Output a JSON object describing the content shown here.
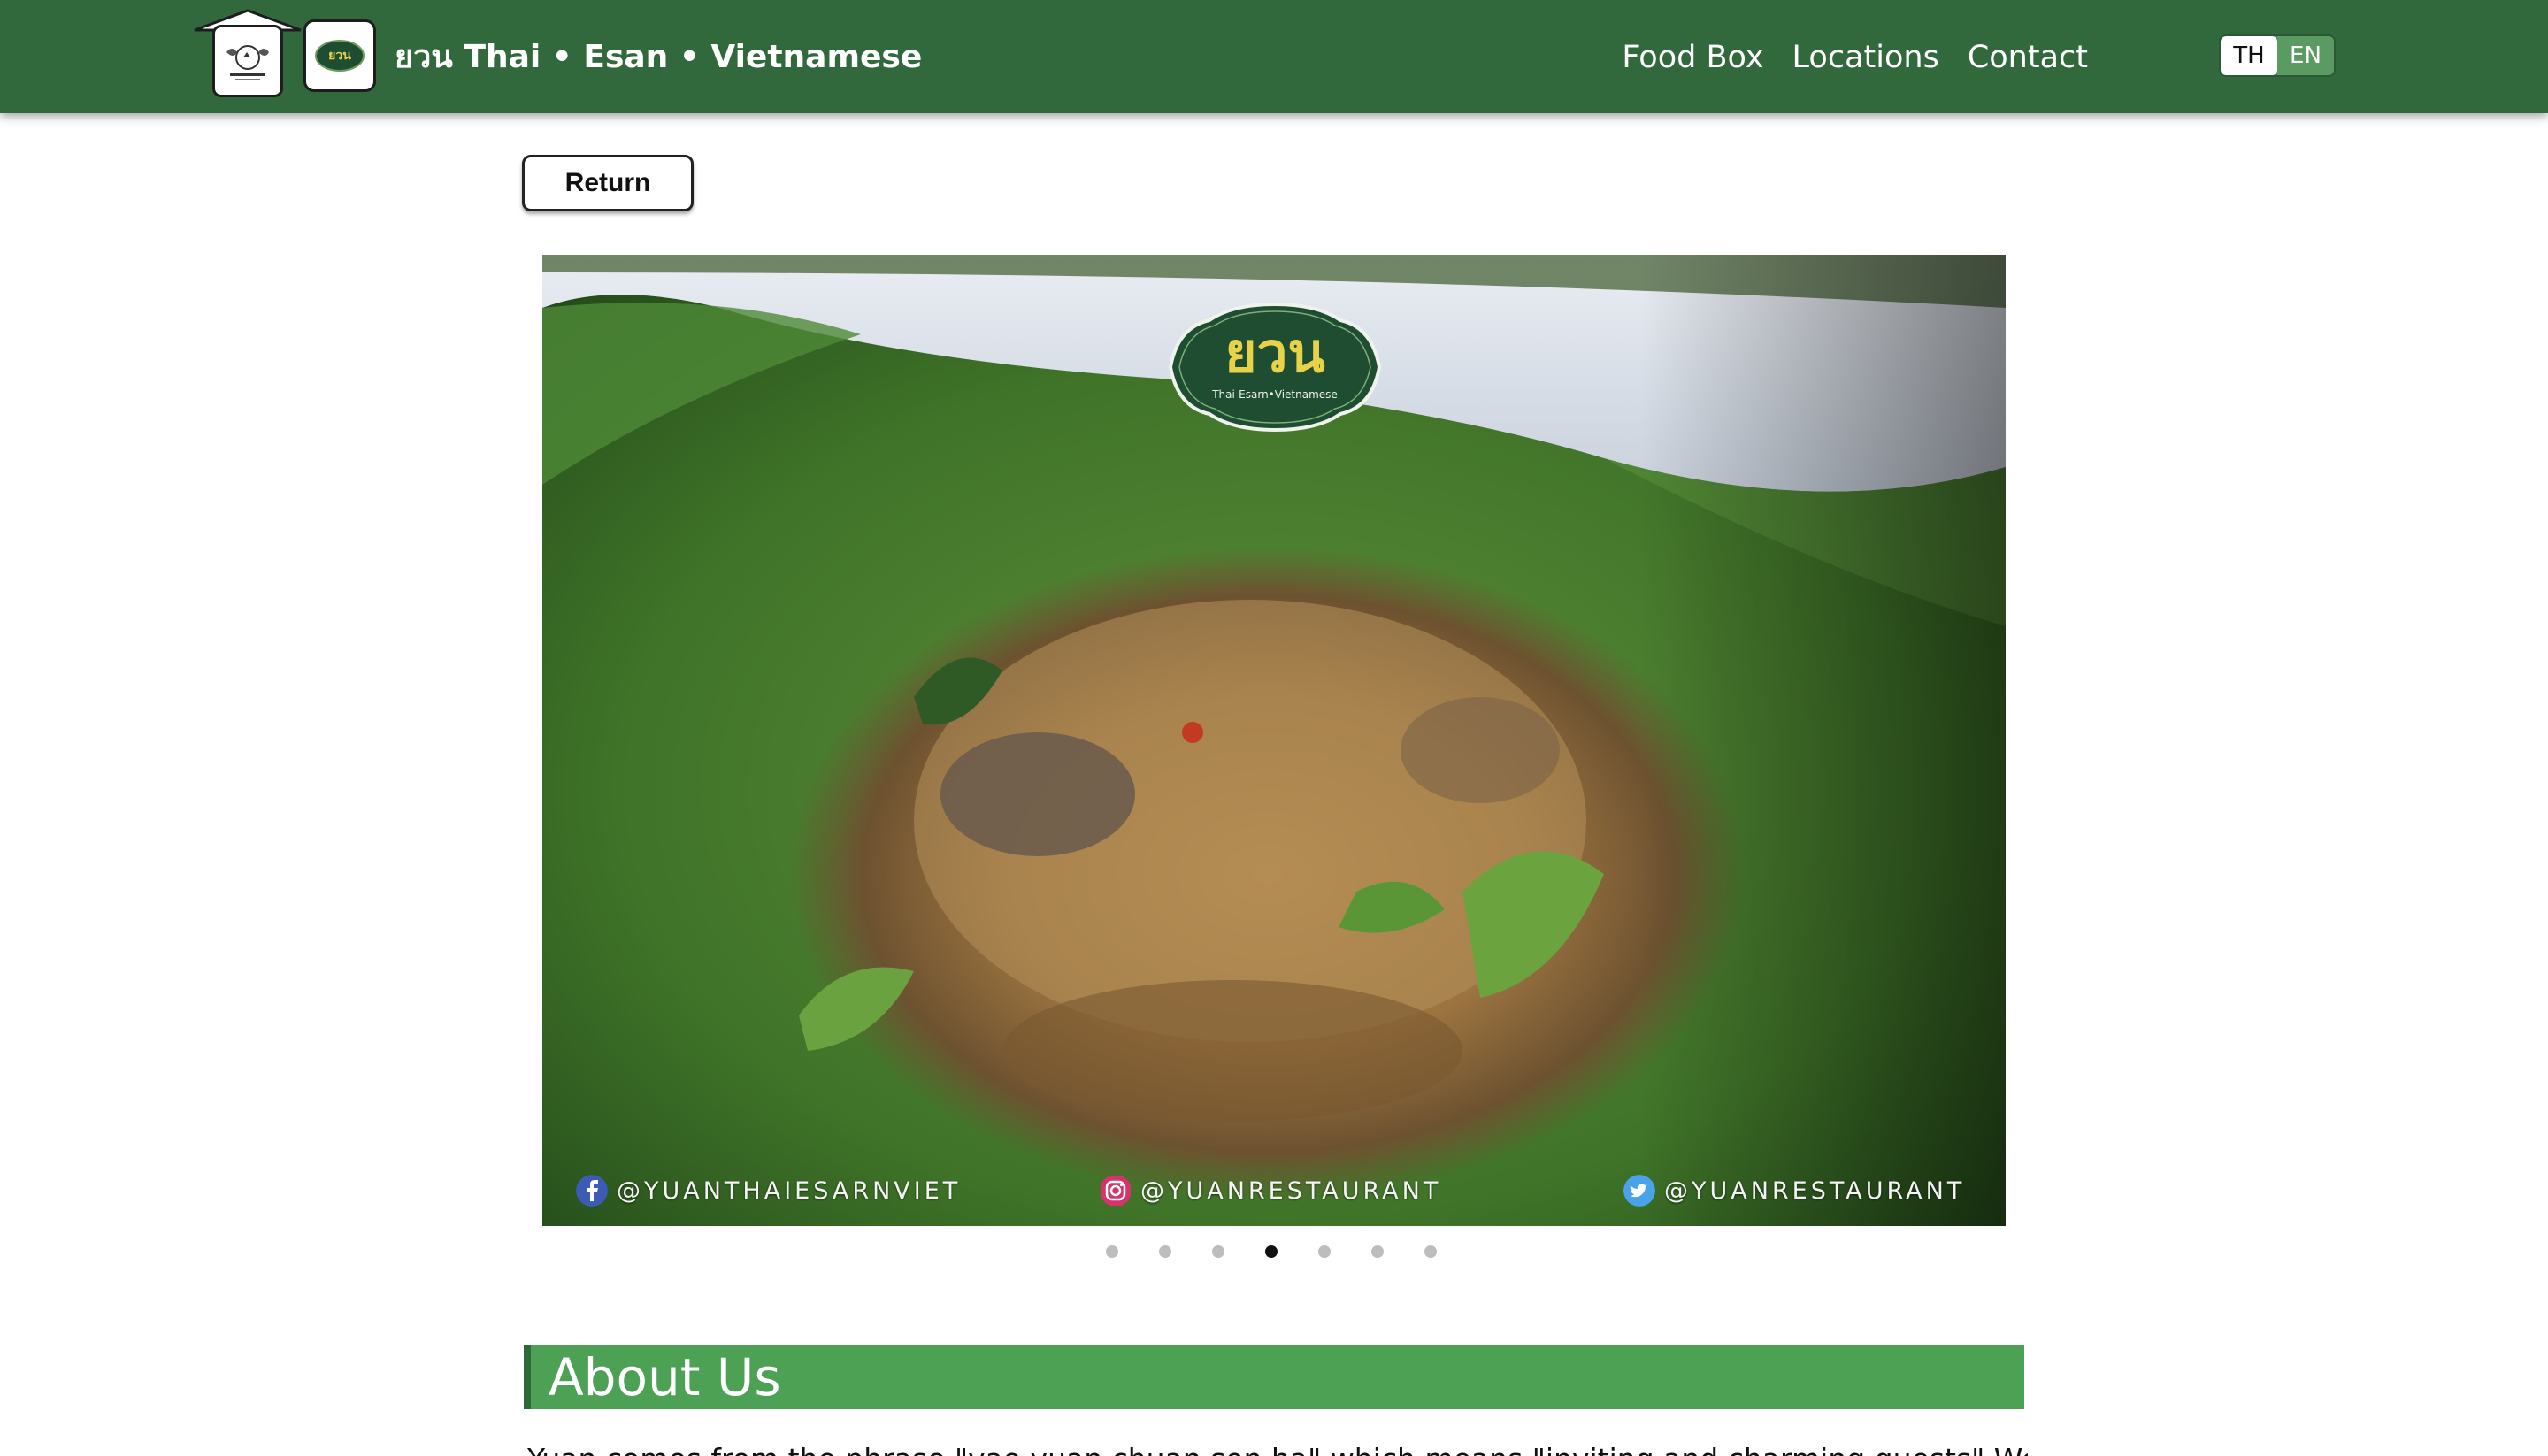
{
  "navbar": {
    "brand_title": "ยวน  Thai • Esan • Vietnamese",
    "home_logo_icon": "house-crest-logo",
    "brand_logo_icon": "yuan-oval-logo",
    "links": [
      {
        "label": "Food Box"
      },
      {
        "label": "Locations"
      },
      {
        "label": "Contact"
      }
    ],
    "lang": {
      "th": "TH",
      "en": "EN",
      "active": "TH"
    }
  },
  "return_button": {
    "label": "Return"
  },
  "carousel": {
    "badge_title": "ยวน",
    "badge_subtitle": "Thai-Esarn•Vietnamese",
    "social": {
      "facebook": "@YUANTHAIESARNVIET",
      "instagram": "@YUANRESTAURANT",
      "twitter": "@YUANRESTAURANT"
    },
    "slide_count": 7,
    "active_slide": 4
  },
  "about": {
    "heading": "About Us",
    "text": "Yuan comes from the phrase \"yao yuan chuan son ha\" which means \"inviting and charming guests\" We pay attention"
  },
  "colors": {
    "navbar": "#31693d",
    "accent_green": "#4ca155",
    "badge_gold": "#e8d24a"
  }
}
